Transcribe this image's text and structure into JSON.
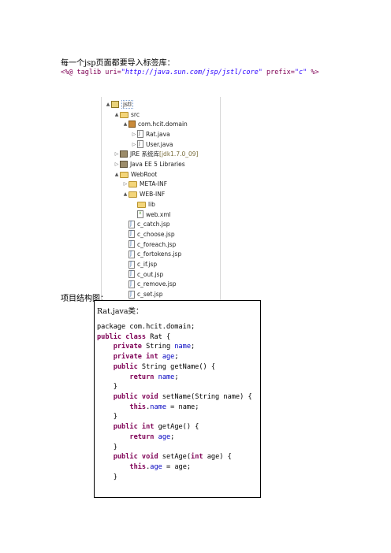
{
  "intro": "每一个jsp页面都要导入标签库：",
  "taglib": {
    "open": "<%@ taglib ",
    "uri_attr": "uri=",
    "uri_value": "\"http://java.sun.com/jsp/jstl/core\"",
    "prefix_attr": " prefix=",
    "prefix_value": "\"c\"",
    "close": " %>"
  },
  "tree": [
    {
      "label": "jstl",
      "icon": "project-icon",
      "toggle": "▲",
      "indent": 0
    },
    {
      "label": "src",
      "icon": "source-folder-icon",
      "toggle": "▲",
      "indent": 1
    },
    {
      "label": "com.hcit.domain",
      "icon": "package-icon",
      "toggle": "▲",
      "indent": 2
    },
    {
      "label": "Rat.java",
      "icon": "java-file-icon",
      "toggle": "▷",
      "indent": 3
    },
    {
      "label": "User.java",
      "icon": "java-file-icon",
      "toggle": "▷",
      "indent": 3
    },
    {
      "label": "JRE 系统库",
      "suffix": " [jdk1.7.0_09]",
      "icon": "library-icon",
      "toggle": "▷",
      "indent": 1
    },
    {
      "label": "Java EE 5 Libraries",
      "icon": "library-icon",
      "toggle": "▷",
      "indent": 1
    },
    {
      "label": "WebRoot",
      "icon": "folder-icon",
      "toggle": "▲",
      "indent": 1
    },
    {
      "label": "META-INF",
      "icon": "folder-icon",
      "toggle": "▷",
      "indent": 2
    },
    {
      "label": "WEB-INF",
      "icon": "folder-icon",
      "toggle": "▲",
      "indent": 2
    },
    {
      "label": "lib",
      "icon": "folder-icon",
      "toggle": "",
      "indent": 3
    },
    {
      "label": "web.xml",
      "icon": "xml-file-icon",
      "toggle": "",
      "indent": 3
    },
    {
      "label": "c_catch.jsp",
      "icon": "jsp-file-icon",
      "toggle": "",
      "indent": 2
    },
    {
      "label": "c_choose.jsp",
      "icon": "jsp-file-icon",
      "toggle": "",
      "indent": 2
    },
    {
      "label": "c_foreach.jsp",
      "icon": "jsp-file-icon",
      "toggle": "",
      "indent": 2
    },
    {
      "label": "c_fortokens.jsp",
      "icon": "jsp-file-icon",
      "toggle": "",
      "indent": 2
    },
    {
      "label": "c_if.jsp",
      "icon": "jsp-file-icon",
      "toggle": "",
      "indent": 2
    },
    {
      "label": "c_out.jsp",
      "icon": "jsp-file-icon",
      "toggle": "",
      "indent": 2
    },
    {
      "label": "c_remove.jsp",
      "icon": "jsp-file-icon",
      "toggle": "",
      "indent": 2
    },
    {
      "label": "c_set.jsp",
      "icon": "jsp-file-icon",
      "toggle": "",
      "indent": 2
    }
  ],
  "structure_label": "项目结构图：",
  "code_caption": "Rat.java类：",
  "code_lines": [
    [
      {
        "t": "package com.hcit.domain;",
        "c": ""
      }
    ],
    [
      {
        "t": "public class",
        "c": "k"
      },
      {
        "t": " Rat {",
        "c": ""
      }
    ],
    [
      {
        "t": "    ",
        "c": ""
      },
      {
        "t": "private",
        "c": "k"
      },
      {
        "t": " String ",
        "c": ""
      },
      {
        "t": "name",
        "c": "f"
      },
      {
        "t": ";",
        "c": ""
      }
    ],
    [
      {
        "t": "    ",
        "c": ""
      },
      {
        "t": "private int",
        "c": "k"
      },
      {
        "t": " ",
        "c": ""
      },
      {
        "t": "age",
        "c": "f"
      },
      {
        "t": ";",
        "c": ""
      }
    ],
    [
      {
        "t": "    ",
        "c": ""
      },
      {
        "t": "public",
        "c": "k"
      },
      {
        "t": " String getName() {",
        "c": ""
      }
    ],
    [
      {
        "t": "        ",
        "c": ""
      },
      {
        "t": "return",
        "c": "k"
      },
      {
        "t": " ",
        "c": ""
      },
      {
        "t": "name",
        "c": "f"
      },
      {
        "t": ";",
        "c": ""
      }
    ],
    [
      {
        "t": "    }",
        "c": ""
      }
    ],
    [
      {
        "t": "    ",
        "c": ""
      },
      {
        "t": "public void",
        "c": "k"
      },
      {
        "t": " setName(String name) {",
        "c": ""
      }
    ],
    [
      {
        "t": "        ",
        "c": ""
      },
      {
        "t": "this",
        "c": "k"
      },
      {
        "t": ".",
        "c": ""
      },
      {
        "t": "name",
        "c": "f"
      },
      {
        "t": " = name;",
        "c": ""
      }
    ],
    [
      {
        "t": "    }",
        "c": ""
      }
    ],
    [
      {
        "t": "    ",
        "c": ""
      },
      {
        "t": "public int",
        "c": "k"
      },
      {
        "t": " getAge() {",
        "c": ""
      }
    ],
    [
      {
        "t": "        ",
        "c": ""
      },
      {
        "t": "return",
        "c": "k"
      },
      {
        "t": " ",
        "c": ""
      },
      {
        "t": "age",
        "c": "f"
      },
      {
        "t": ";",
        "c": ""
      }
    ],
    [
      {
        "t": "    }",
        "c": ""
      }
    ],
    [
      {
        "t": "    ",
        "c": ""
      },
      {
        "t": "public void",
        "c": "k"
      },
      {
        "t": " setAge(",
        "c": ""
      },
      {
        "t": "int",
        "c": "k"
      },
      {
        "t": " age) {",
        "c": ""
      }
    ],
    [
      {
        "t": "        ",
        "c": ""
      },
      {
        "t": "this",
        "c": "k"
      },
      {
        "t": ".",
        "c": ""
      },
      {
        "t": "age",
        "c": "f"
      },
      {
        "t": " = age;",
        "c": ""
      }
    ],
    [
      {
        "t": "    }",
        "c": ""
      }
    ]
  ]
}
